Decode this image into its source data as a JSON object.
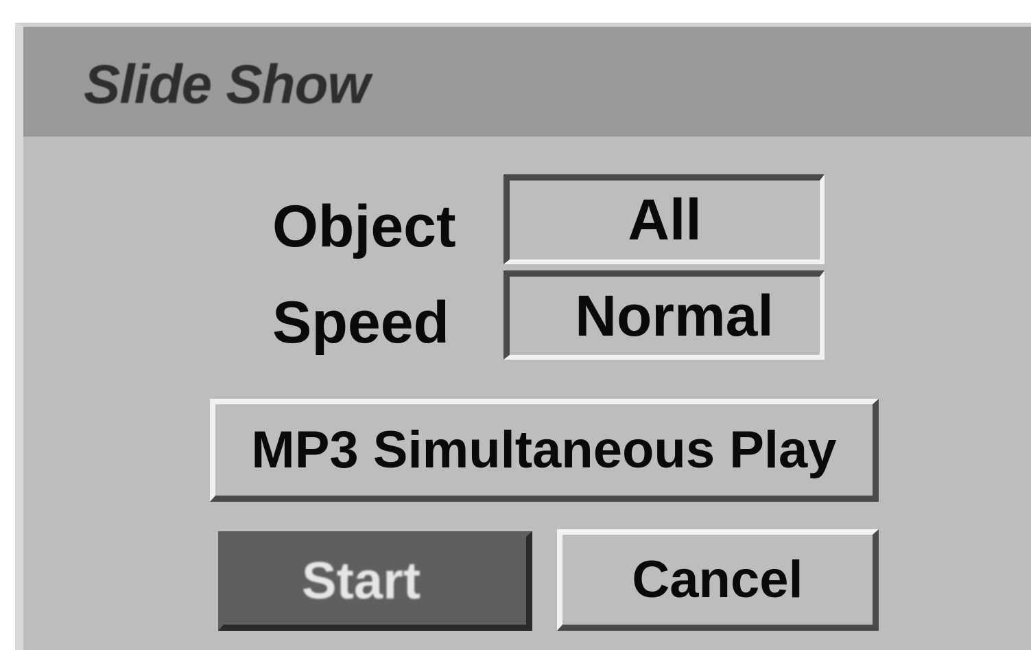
{
  "dialog": {
    "title": "Slide Show"
  },
  "fields": {
    "object_label": "Object",
    "object_value": "All",
    "speed_label": "Speed",
    "speed_value": "Normal"
  },
  "buttons": {
    "mp3_label": "MP3 Simultaneous Play",
    "start_label": "Start",
    "cancel_label": "Cancel"
  },
  "colors": {
    "panel": "#bdbdbd",
    "titlebar": "#9a9a9a",
    "selected_button": "#5f5f5f"
  }
}
